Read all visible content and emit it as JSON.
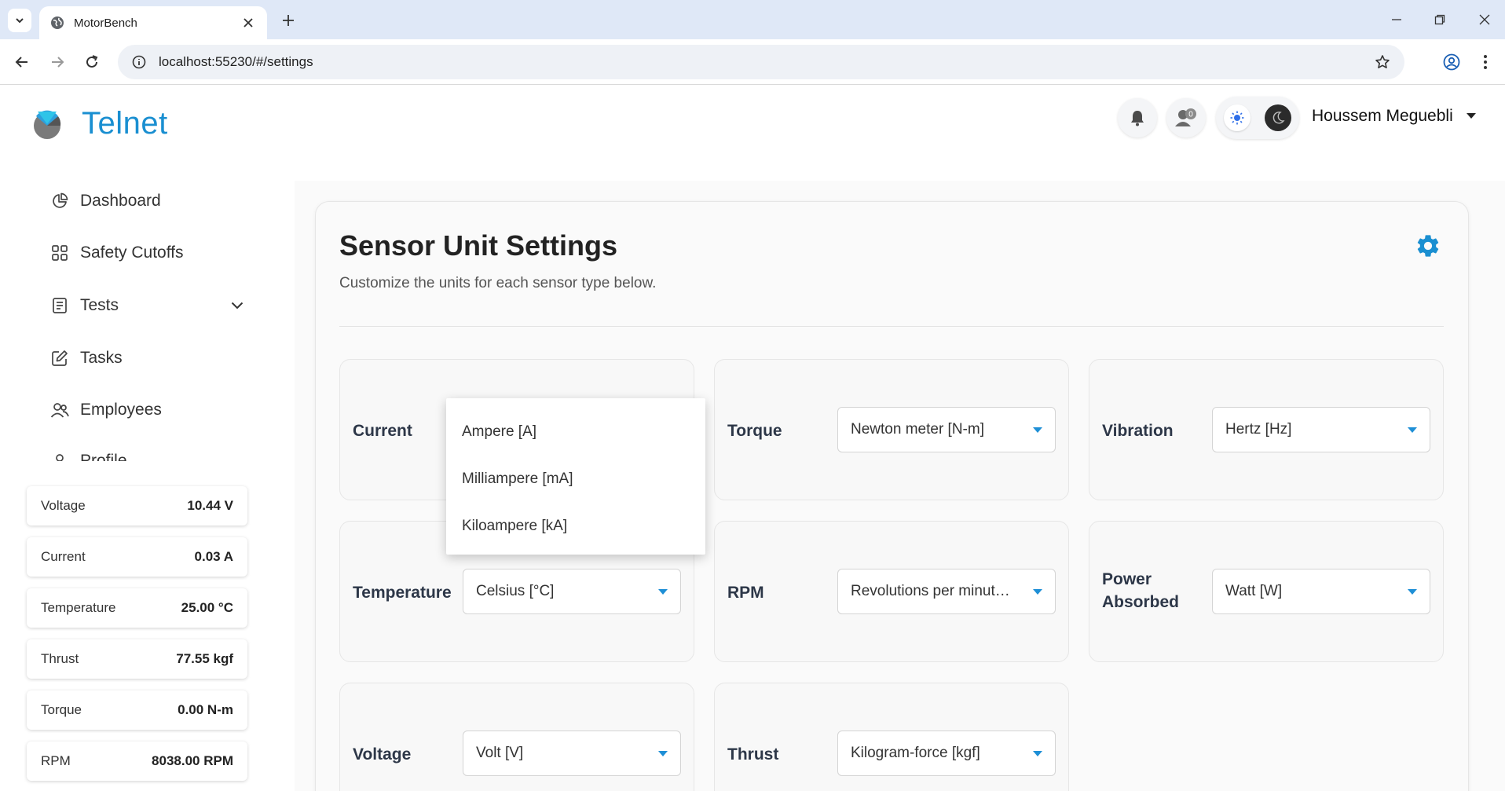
{
  "browser": {
    "tab_title": "MotorBench",
    "url": "localhost:55230/#/settings"
  },
  "app": {
    "brand": "Telnet",
    "notification_count": "0",
    "user_name": "Houssem Meguebli",
    "accent_color": "#1a8fd1"
  },
  "sidebar": {
    "items": [
      {
        "label": "Dashboard",
        "icon": "pie-chart-icon"
      },
      {
        "label": "Safety Cutoffs",
        "icon": "grid-icon"
      },
      {
        "label": "Tests",
        "icon": "clipboard-icon"
      },
      {
        "label": "Tasks",
        "icon": "edit-icon"
      },
      {
        "label": "Employees",
        "icon": "users-icon"
      },
      {
        "label": "Profile",
        "icon": "user-icon"
      }
    ],
    "readouts": [
      {
        "label": "Voltage",
        "value": "10.44 V"
      },
      {
        "label": "Current",
        "value": "0.03 A"
      },
      {
        "label": "Temperature",
        "value": "25.00 °C"
      },
      {
        "label": "Thrust",
        "value": "77.55 kgf"
      },
      {
        "label": "Torque",
        "value": "0.00 N-m"
      },
      {
        "label": "RPM",
        "value": "8038.00 RPM"
      }
    ]
  },
  "main": {
    "title": "Sensor Unit Settings",
    "subtitle": "Customize the units for each sensor type below.",
    "settings": {
      "current": {
        "label": "Current",
        "value": ""
      },
      "torque": {
        "label": "Torque",
        "value": "Newton meter [N-m]"
      },
      "vibration": {
        "label": "Vibration",
        "value": "Hertz [Hz]"
      },
      "temperature": {
        "label": "Temperature",
        "value": "Celsius [°C]"
      },
      "rpm": {
        "label": "RPM",
        "value": "Revolutions per minute [RPM]"
      },
      "power_absorbed": {
        "label_line1": "Power",
        "label_line2": "Absorbed",
        "value": "Watt [W]"
      },
      "voltage": {
        "label": "Voltage",
        "value": "Volt [V]"
      },
      "thrust": {
        "label": "Thrust",
        "value": "Kilogram-force [kgf]"
      }
    },
    "dropdown_options": [
      "Ampere [A]",
      "Milliampere [mA]",
      "Kiloampere [kA]"
    ]
  }
}
